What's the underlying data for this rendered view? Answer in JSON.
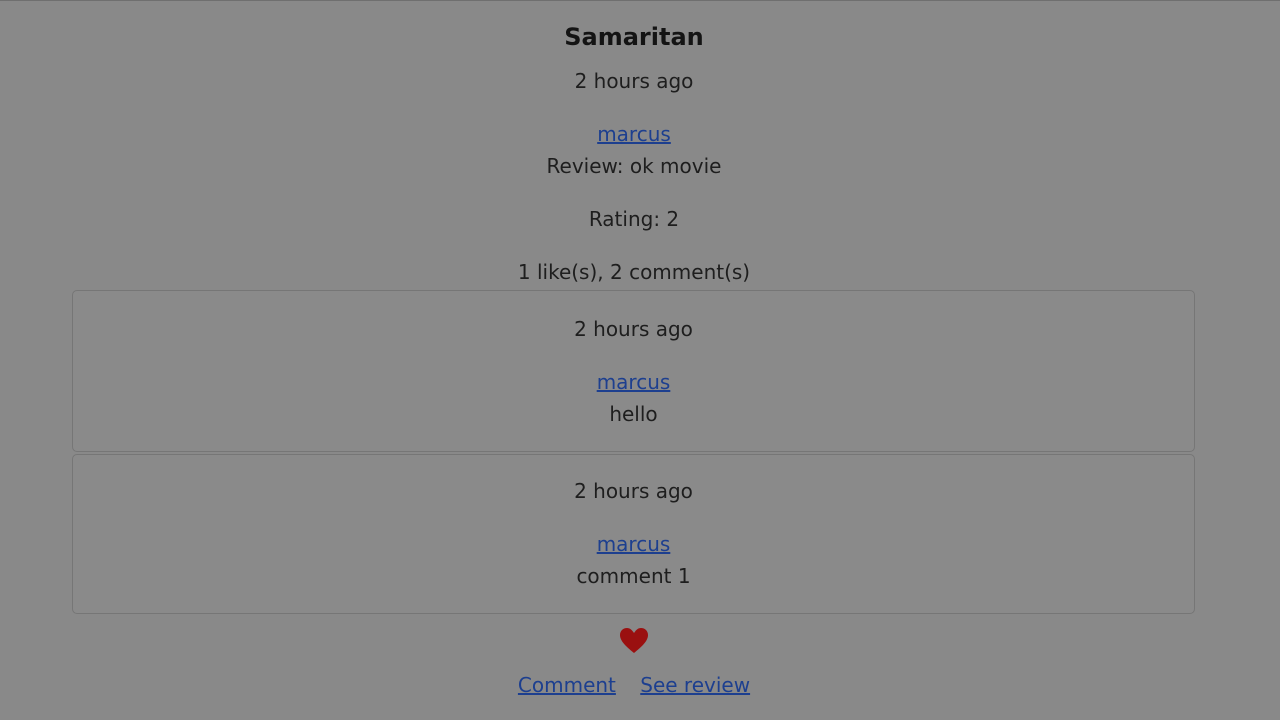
{
  "review": {
    "title": "Samaritan",
    "time": "2 hours ago",
    "author": "marcus",
    "text": "Review: ok movie",
    "rating": "Rating: 2",
    "stats": "1 like(s), 2 comment(s)"
  },
  "comments": [
    {
      "time": "2 hours ago",
      "author": "marcus",
      "text": "hello"
    },
    {
      "time": "2 hours ago",
      "author": "marcus",
      "text": "comment 1"
    }
  ],
  "actions": {
    "like_icon": "heart-icon",
    "like_color": "#9a1010",
    "comment_label": "Comment",
    "see_review_label": "See review"
  }
}
